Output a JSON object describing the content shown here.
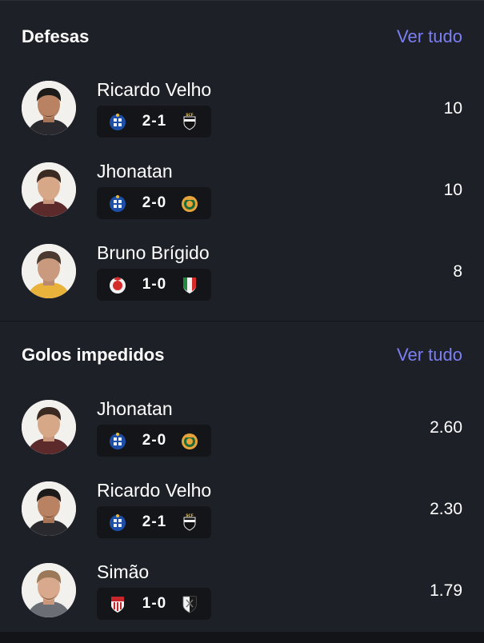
{
  "sections": [
    {
      "title": "Defesas",
      "see_all": "Ver tudo",
      "rows": [
        {
          "name": "Ricardo Velho",
          "score": "2-1",
          "home_badge": "fc-porto-crest-icon",
          "away_badge": "farense-crest-icon",
          "value": "10"
        },
        {
          "name": "Jhonatan",
          "score": "2-0",
          "home_badge": "fc-porto-crest-icon",
          "away_badge": "rio-ave-crest-icon",
          "value": "10"
        },
        {
          "name": "Bruno Brígido",
          "score": "1-0",
          "home_badge": "benfica-crest-icon",
          "away_badge": "estrela-amadora-crest-icon",
          "value": "8"
        }
      ]
    },
    {
      "title": "Golos impedidos",
      "see_all": "Ver tudo",
      "rows": [
        {
          "name": "Jhonatan",
          "score": "2-0",
          "home_badge": "fc-porto-crest-icon",
          "away_badge": "rio-ave-crest-icon",
          "value": "2.60"
        },
        {
          "name": "Ricardo Velho",
          "score": "2-1",
          "home_badge": "fc-porto-crest-icon",
          "away_badge": "farense-crest-icon",
          "value": "2.30"
        },
        {
          "name": "Simão",
          "score": "1-0",
          "home_badge": "afs-crest-icon",
          "away_badge": "vitoria-guimaraes-crest-icon",
          "value": "1.79"
        }
      ]
    }
  ],
  "colors": {
    "background": "#121418",
    "card": "#1d2026",
    "accent": "#7b7ff2",
    "pill": "#131519",
    "text": "#ffffff"
  }
}
